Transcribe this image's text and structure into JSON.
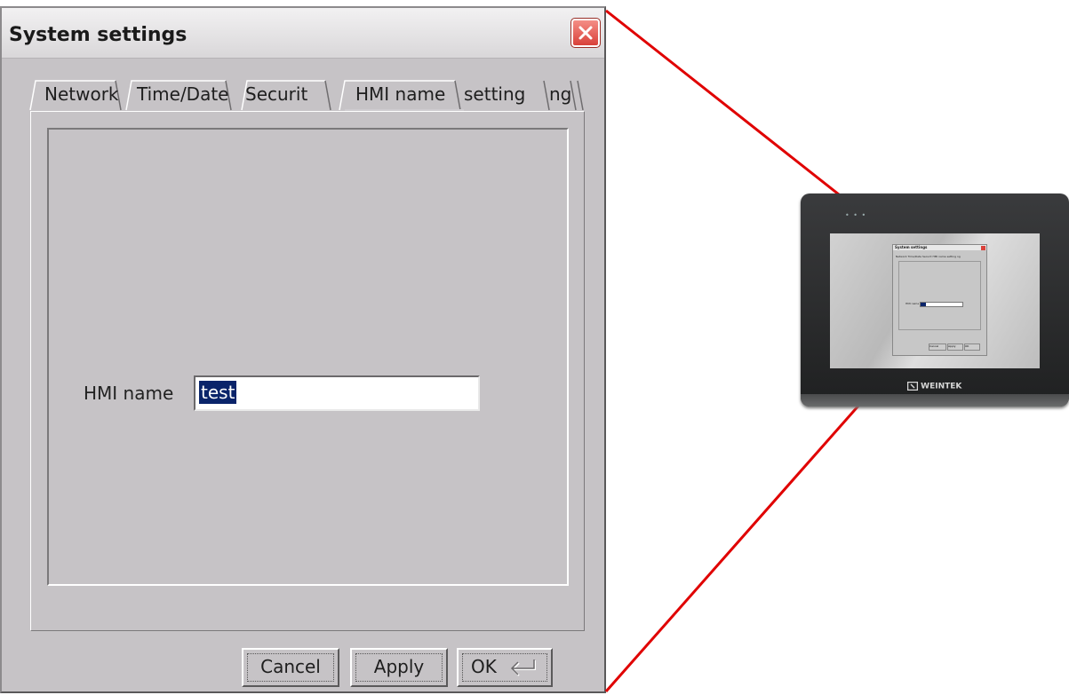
{
  "dialog": {
    "title": "System settings",
    "close_icon": "close-icon",
    "tabs": [
      {
        "label": "Network"
      },
      {
        "label": "Time/Date"
      },
      {
        "label": "Securit"
      },
      {
        "label": "HMI name"
      },
      {
        "label": "setting"
      },
      {
        "label": "ng"
      }
    ],
    "active_tab": "HMI name",
    "hmi_name_label": "HMI name",
    "hmi_name_value": "test",
    "buttons": {
      "cancel": "Cancel",
      "apply": "Apply",
      "ok": "OK",
      "ok_icon": "enter-return-icon"
    }
  },
  "device": {
    "brand": "WEINTEK",
    "leds": "• • •",
    "mini_title": "System settings",
    "mini_tabs": "Network  Time/Date  Securit  HMI name setting ng",
    "mini_label": "HMI name",
    "mini_buttons": [
      "Cancel",
      "Apply",
      "OK"
    ]
  },
  "colors": {
    "dialog_bg": "#c6c3c6",
    "selection": "#0a246a",
    "callout_line": "#e00000",
    "close_button": "#d9413a"
  }
}
